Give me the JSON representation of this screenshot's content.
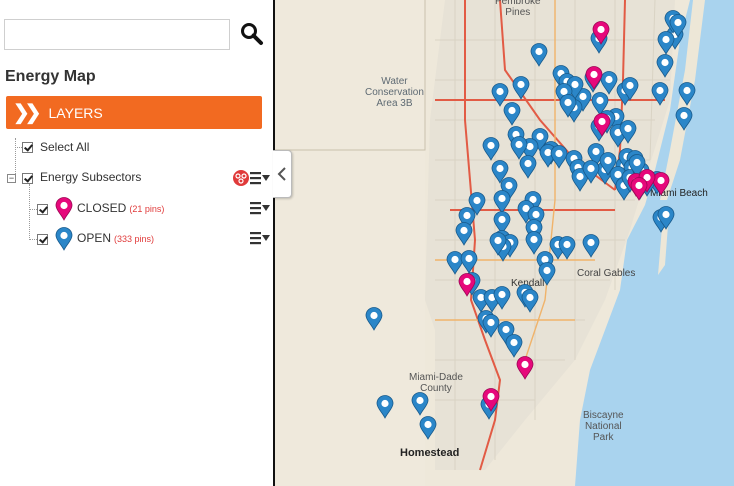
{
  "search": {
    "placeholder": "",
    "value": ""
  },
  "sidebar": {
    "title": "Energy Map",
    "layers_label": "LAYERS",
    "select_all_label": "Select All",
    "group_label": "Energy Subsectors",
    "layers": [
      {
        "label": "CLOSED",
        "count": "(21 pins)",
        "color": "#e6087b",
        "checked": true
      },
      {
        "label": "OPEN",
        "count": "(333 pins)",
        "color": "#2b86c8",
        "checked": true
      }
    ]
  },
  "colors": {
    "accent": "#f26a21",
    "closed_pin": "#e6087b",
    "open_pin": "#2b86c8",
    "water": "#a9d3ee",
    "land": "#eee8da",
    "highway": "#e25b45"
  },
  "map": {
    "labels": {
      "pembroke_pines": "Pembroke\nPines",
      "water_conservation": "Water\nConservation\nArea 3B",
      "miami_beach": "Miami Beach",
      "coral_gables": "Coral Gables",
      "kendall": "Kendall",
      "miami_dade_county": "Miami-Dade\nCounty",
      "homestead": "Homestead",
      "biscayne_national_park": "Biscayne\nNational\nPark"
    }
  }
}
